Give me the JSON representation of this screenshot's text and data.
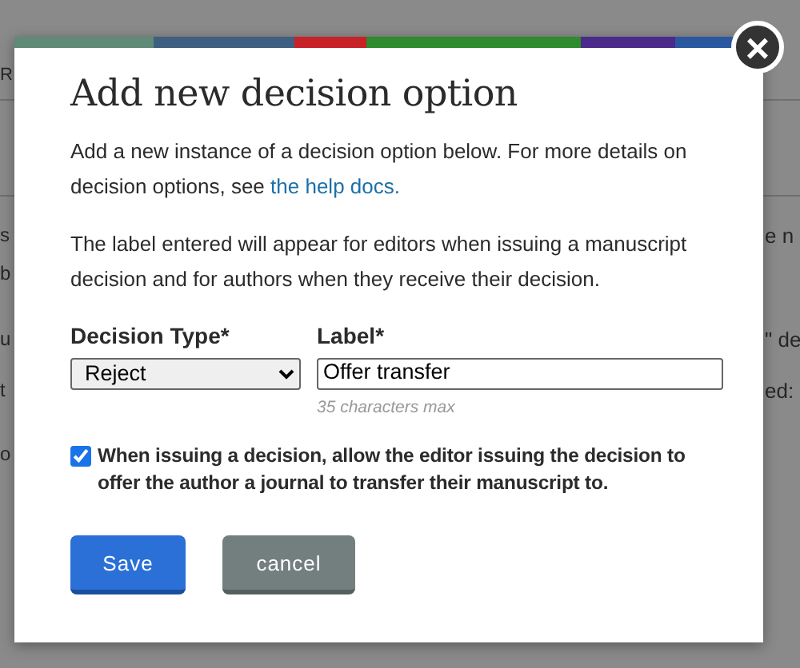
{
  "background_page": {
    "left_fragments": [
      "R",
      "s",
      "b",
      "u",
      "t",
      "o"
    ],
    "right_fragments": [
      "e n",
      "\" de",
      "ed:"
    ]
  },
  "dialog": {
    "title": "Add new decision option",
    "intro": "Add a new instance of a decision option below. For more details on decision options, see",
    "help_link": "the help docs.",
    "note": "The label entered will appear for editors when issuing a manuscript decision and for authors when they receive their decision.",
    "decision_type": {
      "label": "Decision Type*",
      "value": "Reject"
    },
    "label_field": {
      "label": "Label*",
      "value": "Offer transfer",
      "hint": "35 characters max"
    },
    "transfer_option": {
      "checked": true,
      "text": "When issuing a decision, allow the editor issuing the decision to offer the author a journal to transfer their manuscript to."
    },
    "buttons": [
      {
        "kind": "primary",
        "label": "Save"
      },
      {
        "kind": "secondary",
        "label": "cancel"
      }
    ],
    "close": {
      "icon": "×"
    }
  }
}
